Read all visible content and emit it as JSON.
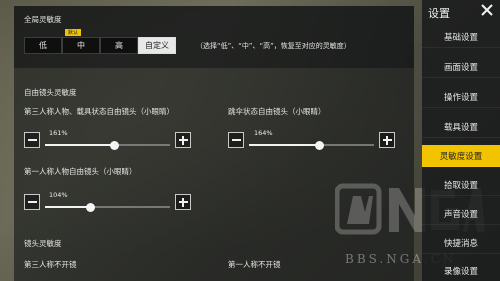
{
  "global": {
    "title": "全局灵敏度",
    "options": [
      "低",
      "中",
      "高",
      "自定义"
    ],
    "selected": "自定义",
    "badge": "默认",
    "hint": "（选择“低”、“中”、“高”，恢复至对应的灵敏度）"
  },
  "freecam": {
    "title": "自由镜头灵敏度",
    "sliders": [
      {
        "label": "第三人称人物、载具状态自由镜头（小眼睛）",
        "value_text": "161%",
        "value": 1.61
      },
      {
        "label": "跳伞状态自由镜头（小眼睛）",
        "value_text": "164%",
        "value": 1.64
      },
      {
        "label": "第一人称人物自由镜头（小眼睛）",
        "value_text": "104%",
        "value": 1.04
      }
    ]
  },
  "camera": {
    "title": "镜头灵敏度",
    "left_label": "第三人称不开镜",
    "right_label": "第一人称不开镜"
  },
  "sidebar": {
    "title": "设置",
    "items": [
      "基础设置",
      "画面设置",
      "操作设置",
      "载具设置",
      "灵敏度设置",
      "拾取设置",
      "声音设置",
      "快捷消息",
      "录像设置"
    ],
    "active": "灵敏度设置"
  },
  "watermark": {
    "text": "BBS.NGA.CN"
  },
  "colors": {
    "accent": "#f2c400"
  }
}
